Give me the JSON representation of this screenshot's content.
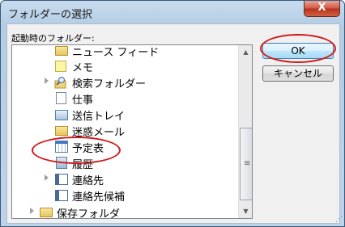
{
  "window": {
    "title": "フォルダーの選択",
    "close_label": "X"
  },
  "tree": {
    "caption": "起動時のフォルダー:",
    "items": [
      {
        "label": "ニュース フィード",
        "icon": "folder-icon",
        "expander": false
      },
      {
        "label": "メモ",
        "icon": "notes-icon",
        "expander": false
      },
      {
        "label": "検索フォルダー",
        "icon": "search-folder-icon",
        "expander": true
      },
      {
        "label": "仕事",
        "icon": "tasks-icon",
        "expander": false
      },
      {
        "label": "送信トレイ",
        "icon": "outbox-icon",
        "expander": false
      },
      {
        "label": "迷惑メール",
        "icon": "junk-mail-icon",
        "expander": false
      },
      {
        "label": "予定表",
        "icon": "calendar-icon",
        "expander": false
      },
      {
        "label": "履歴",
        "icon": "journal-icon",
        "expander": false
      },
      {
        "label": "連絡先",
        "icon": "contacts-icon",
        "expander": true
      },
      {
        "label": "連絡先候補",
        "icon": "contacts-icon",
        "expander": false
      },
      {
        "label": "保存フォルダ",
        "icon": "folder-icon",
        "expander": true
      }
    ]
  },
  "buttons": {
    "ok": "OK",
    "cancel": "キャンセル"
  },
  "scrollbar": {
    "up": "▲",
    "down": "▼",
    "grip": "≡"
  },
  "colors": {
    "annotation": "#d01818",
    "titlebar": "#bed3e8",
    "close": "#c8402a"
  }
}
